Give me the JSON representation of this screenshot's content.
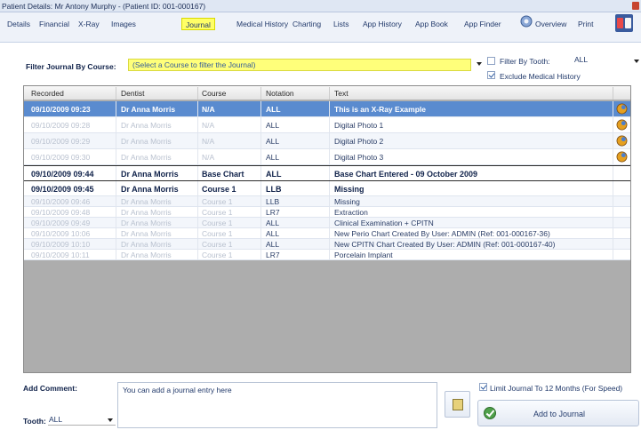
{
  "window": {
    "title": "Patient Details: Mr Antony Murphy - (Patient ID: 001-000167)"
  },
  "menu": {
    "items": [
      "Details",
      "Financial",
      "X-Ray",
      "Images",
      "Journal",
      "Medical History",
      "Charting",
      "Lists",
      "App History",
      "App Book",
      "App Finder",
      "Overview",
      "Print"
    ],
    "active": "Journal"
  },
  "filter": {
    "label": "Filter Journal By Course:",
    "course_placeholder": "(Select a Course to filter the Journal)",
    "by_tooth_label": "Filter By Tooth:",
    "by_tooth_checked": false,
    "tooth_value": "ALL",
    "exclude_medical_label": "Exclude Medical History",
    "exclude_medical_checked": true
  },
  "journal": {
    "columns": [
      "Recorded",
      "Dentist",
      "Course",
      "Notation",
      "Text"
    ],
    "rows": [
      {
        "recorded": "09/10/2009 09:23",
        "dentist": "Dr Anna Morris",
        "course": "N/A",
        "notation": "ALL",
        "text": "This is an X-Ray Example",
        "style": "selected",
        "icon": "photo-icon"
      },
      {
        "recorded": "09/10/2009 09:28",
        "dentist": "Dr Anna Morris",
        "course": "N/A",
        "notation": "ALL",
        "text": "Digital Photo 1",
        "style": "muted",
        "icon": "photo-icon"
      },
      {
        "recorded": "09/10/2009 09:29",
        "dentist": "Dr Anna Morris",
        "course": "N/A",
        "notation": "ALL",
        "text": "Digital Photo 2",
        "style": "muted alt",
        "icon": "photo-icon"
      },
      {
        "recorded": "09/10/2009 09:30",
        "dentist": "Dr Anna Morris",
        "course": "N/A",
        "notation": "ALL",
        "text": "Digital Photo 3",
        "style": "muted",
        "icon": "photo-icon"
      },
      {
        "recorded": "09/10/2009 09:44",
        "dentist": "Dr Anna Morris",
        "course": "Base Chart",
        "notation": "ALL",
        "text": "Base Chart Entered - 09 October 2009",
        "style": "bold framed",
        "icon": ""
      },
      {
        "recorded": "09/10/2009 09:45",
        "dentist": "Dr Anna Morris",
        "course": "Course 1",
        "notation": "LLB",
        "text": "Missing",
        "style": "bold",
        "icon": ""
      },
      {
        "recorded": "09/10/2009 09:46",
        "dentist": "Dr Anna Morris",
        "course": "Course 1",
        "notation": "LLB",
        "text": "Missing",
        "style": "muted alt",
        "icon": ""
      },
      {
        "recorded": "09/10/2009 09:48",
        "dentist": "Dr Anna Morris",
        "course": "Course 1",
        "notation": "LR7",
        "text": "Extraction",
        "style": "muted",
        "icon": ""
      },
      {
        "recorded": "09/10/2009 09:49",
        "dentist": "Dr Anna Morris",
        "course": "Course 1",
        "notation": "ALL",
        "text": "Clinical Examination + CPITN",
        "style": "muted alt",
        "icon": ""
      },
      {
        "recorded": "09/10/2009 10:06",
        "dentist": "Dr Anna Morris",
        "course": "Course 1",
        "notation": "ALL",
        "text": "New Perio Chart Created By User:  ADMIN  (Ref: 001-000167-36)",
        "style": "muted",
        "icon": ""
      },
      {
        "recorded": "09/10/2009 10:10",
        "dentist": "Dr Anna Morris",
        "course": "Course 1",
        "notation": "ALL",
        "text": "New CPITN Chart Created By User:  ADMIN  (Ref: 001-000167-40)",
        "style": "muted alt",
        "icon": ""
      },
      {
        "recorded": "09/10/2009 10:11",
        "dentist": "Dr Anna Morris",
        "course": "Course 1",
        "notation": "LR7",
        "text": "Porcelain Implant",
        "style": "muted",
        "icon": ""
      }
    ]
  },
  "comment": {
    "label": "Add Comment:",
    "value": "You can add a journal entry here",
    "tooth_label": "Tooth:",
    "tooth_value": "ALL",
    "limit_label": "Limit Journal To 12 Months (For Speed)",
    "limit_checked": true,
    "add_button": "Add to Journal"
  },
  "colors": {
    "selected_row": "#5a8bcf",
    "active_tab": "#ffff66",
    "course_filter_bg": "#ffff7a",
    "grid_background": "#adadad"
  }
}
